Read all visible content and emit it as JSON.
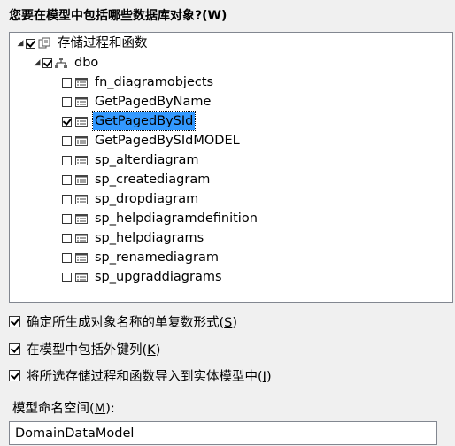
{
  "prompt": "您要在模型中包括哪些数据库对象?(W)",
  "tree": {
    "root": {
      "label": "存储过程和函数",
      "checked": true,
      "expanded": true,
      "icon": "stored-procedures-folder-icon"
    },
    "schema": {
      "label": "dbo",
      "checked": true,
      "expanded": true,
      "icon": "schema-icon"
    },
    "items": [
      {
        "label": "fn_diagramobjects",
        "checked": false,
        "selected": false
      },
      {
        "label": "GetPagedByName",
        "checked": false,
        "selected": false
      },
      {
        "label": "GetPagedBySId",
        "checked": true,
        "selected": true
      },
      {
        "label": "GetPagedBySIdMODEL",
        "checked": false,
        "selected": false
      },
      {
        "label": "sp_alterdiagram",
        "checked": false,
        "selected": false
      },
      {
        "label": "sp_creatediagram",
        "checked": false,
        "selected": false
      },
      {
        "label": "sp_dropdiagram",
        "checked": false,
        "selected": false
      },
      {
        "label": "sp_helpdiagramdefinition",
        "checked": false,
        "selected": false
      },
      {
        "label": "sp_helpdiagrams",
        "checked": false,
        "selected": false
      },
      {
        "label": "sp_renamediagram",
        "checked": false,
        "selected": false
      },
      {
        "label": "sp_upgraddiagrams",
        "checked": false,
        "selected": false
      }
    ]
  },
  "options": [
    {
      "text": "确定所生成对象名称的单复数形式",
      "accel": "S",
      "checked": true
    },
    {
      "text": "在模型中包括外键列",
      "accel": "K",
      "checked": true
    },
    {
      "text": "将所选存储过程和函数导入到实体模型中",
      "accel": "I",
      "checked": true
    }
  ],
  "namespace": {
    "label": "模型命名空间",
    "accel": "M",
    "value": "DomainDataModel"
  },
  "colors": {
    "selection": "#3399ff",
    "background": "#f0f0f0",
    "border": "#828790"
  }
}
